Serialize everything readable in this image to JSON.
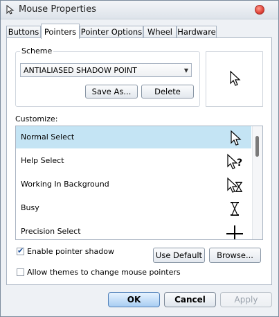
{
  "window": {
    "title": "Mouse Properties"
  },
  "tabs": [
    {
      "label": "Buttons"
    },
    {
      "label": "Pointers",
      "active": true
    },
    {
      "label": "Pointer Options"
    },
    {
      "label": "Wheel"
    },
    {
      "label": "Hardware"
    }
  ],
  "scheme": {
    "group_label": "Scheme",
    "selected": "ANTIALIASED SHADOW POINT",
    "save_as_label": "Save As...",
    "delete_label": "Delete"
  },
  "customize": {
    "label": "Customize:",
    "items": [
      {
        "label": "Normal Select",
        "icon": "arrow-cursor-icon",
        "selected": true
      },
      {
        "label": "Help Select",
        "icon": "help-cursor-icon"
      },
      {
        "label": "Working In Background",
        "icon": "working-cursor-icon"
      },
      {
        "label": "Busy",
        "icon": "hourglass-cursor-icon"
      },
      {
        "label": "Precision Select",
        "icon": "crosshair-cursor-icon"
      }
    ]
  },
  "options": {
    "enable_shadow_label": "Enable pointer shadow",
    "enable_shadow_checked": true,
    "allow_themes_label": "Allow themes to change mouse pointers",
    "allow_themes_checked": false,
    "use_default_label": "Use Default",
    "browse_label": "Browse..."
  },
  "dialog": {
    "ok_label": "OK",
    "cancel_label": "Cancel",
    "apply_label": "Apply"
  },
  "colors": {
    "selection": "#c4e4f4",
    "accent": "#4f7fb8"
  }
}
